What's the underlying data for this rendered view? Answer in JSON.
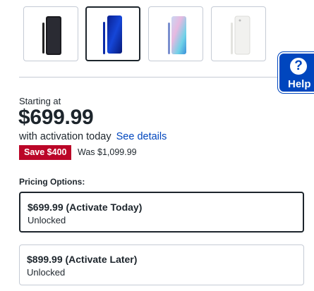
{
  "colors": {
    "accent": "#0046be",
    "text": "#1d252c",
    "sale_badge": "#bb0628",
    "border": "#c5cbd5"
  },
  "variants": [
    {
      "color_name": "Aura Black",
      "selected": false
    },
    {
      "color_name": "Aura Blue",
      "selected": true
    },
    {
      "color_name": "Aura Glow",
      "selected": false
    },
    {
      "color_name": "Aura White",
      "selected": false
    }
  ],
  "help": {
    "icon": "question-icon",
    "label": "Help"
  },
  "pricing": {
    "starting_at": "Starting at",
    "price": "$699.99",
    "activation_text": "with activation today",
    "see_details": "See details",
    "save_badge": "Save $400",
    "was_price": "Was $1,099.99"
  },
  "pricing_options": {
    "label": "Pricing Options:",
    "options": [
      {
        "title": "$699.99 (Activate Today)",
        "subtitle": "Unlocked",
        "selected": true
      },
      {
        "title": "$899.99 (Activate Later)",
        "subtitle": "Unlocked",
        "selected": false
      }
    ]
  }
}
